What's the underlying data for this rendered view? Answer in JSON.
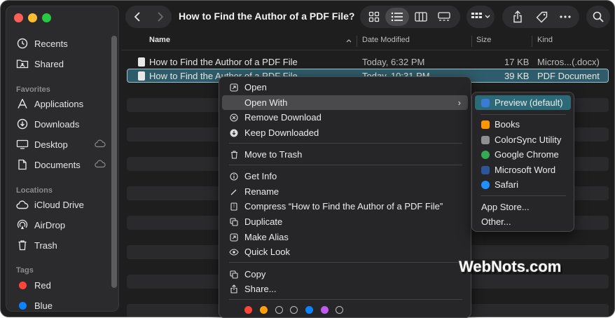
{
  "window": {
    "title": "How to Find the Author of a PDF File?"
  },
  "sidebar": {
    "top_items": [
      {
        "label": "Recents",
        "icon": "clock-icon"
      },
      {
        "label": "Shared",
        "icon": "shared-folder-icon"
      }
    ],
    "favorites_heading": "Favorites",
    "favorites": [
      {
        "label": "Applications",
        "icon": "applications-icon"
      },
      {
        "label": "Downloads",
        "icon": "download-icon"
      },
      {
        "label": "Desktop",
        "icon": "desktop-icon",
        "cloud": true
      },
      {
        "label": "Documents",
        "icon": "document-icon",
        "cloud": true
      }
    ],
    "locations_heading": "Locations",
    "locations": [
      {
        "label": "iCloud Drive",
        "icon": "cloud-icon"
      },
      {
        "label": "AirDrop",
        "icon": "airdrop-icon"
      },
      {
        "label": "Trash",
        "icon": "trash-icon"
      }
    ],
    "tags_heading": "Tags",
    "tags": [
      {
        "label": "Red",
        "color": "#ff453a"
      },
      {
        "label": "Blue",
        "color": "#0a84ff"
      }
    ]
  },
  "columns": {
    "name": "Name",
    "date": "Date Modified",
    "size": "Size",
    "kind": "Kind"
  },
  "files": [
    {
      "name": "How to Find the Author of a PDF File",
      "date": "Today, 6:32 PM",
      "size": "17 KB",
      "kind": "Micros...(.docx)"
    },
    {
      "name": "How to Find the Author of a PDF File",
      "date": "Today, 10:31 PM",
      "size": "39 KB",
      "kind": "PDF Document"
    }
  ],
  "context_menu": {
    "open": "Open",
    "open_with": "Open With",
    "remove_download": "Remove Download",
    "keep_downloaded": "Keep Downloaded",
    "move_to_trash": "Move to Trash",
    "get_info": "Get Info",
    "rename": "Rename",
    "compress": "Compress “How to Find the Author of a PDF File”",
    "duplicate": "Duplicate",
    "make_alias": "Make Alias",
    "quick_look": "Quick Look",
    "copy": "Copy",
    "share": "Share...",
    "tag_colors": [
      "#ff453a",
      "#ff9f0a",
      "none",
      "none",
      "#0a84ff",
      "#bf5af2",
      "none"
    ]
  },
  "open_with_menu": {
    "default": "Preview (default)",
    "apps": [
      {
        "label": "Books",
        "color": "#ff9500"
      },
      {
        "label": "ColorSync Utility",
        "color": "#8e8e93"
      },
      {
        "label": "Google Chrome",
        "color": "#34a853"
      },
      {
        "label": "Microsoft Word",
        "color": "#2b579a"
      },
      {
        "label": "Safari",
        "color": "#1e90ff"
      }
    ],
    "app_store": "App Store...",
    "other": "Other..."
  },
  "watermark": "WebNots.com"
}
